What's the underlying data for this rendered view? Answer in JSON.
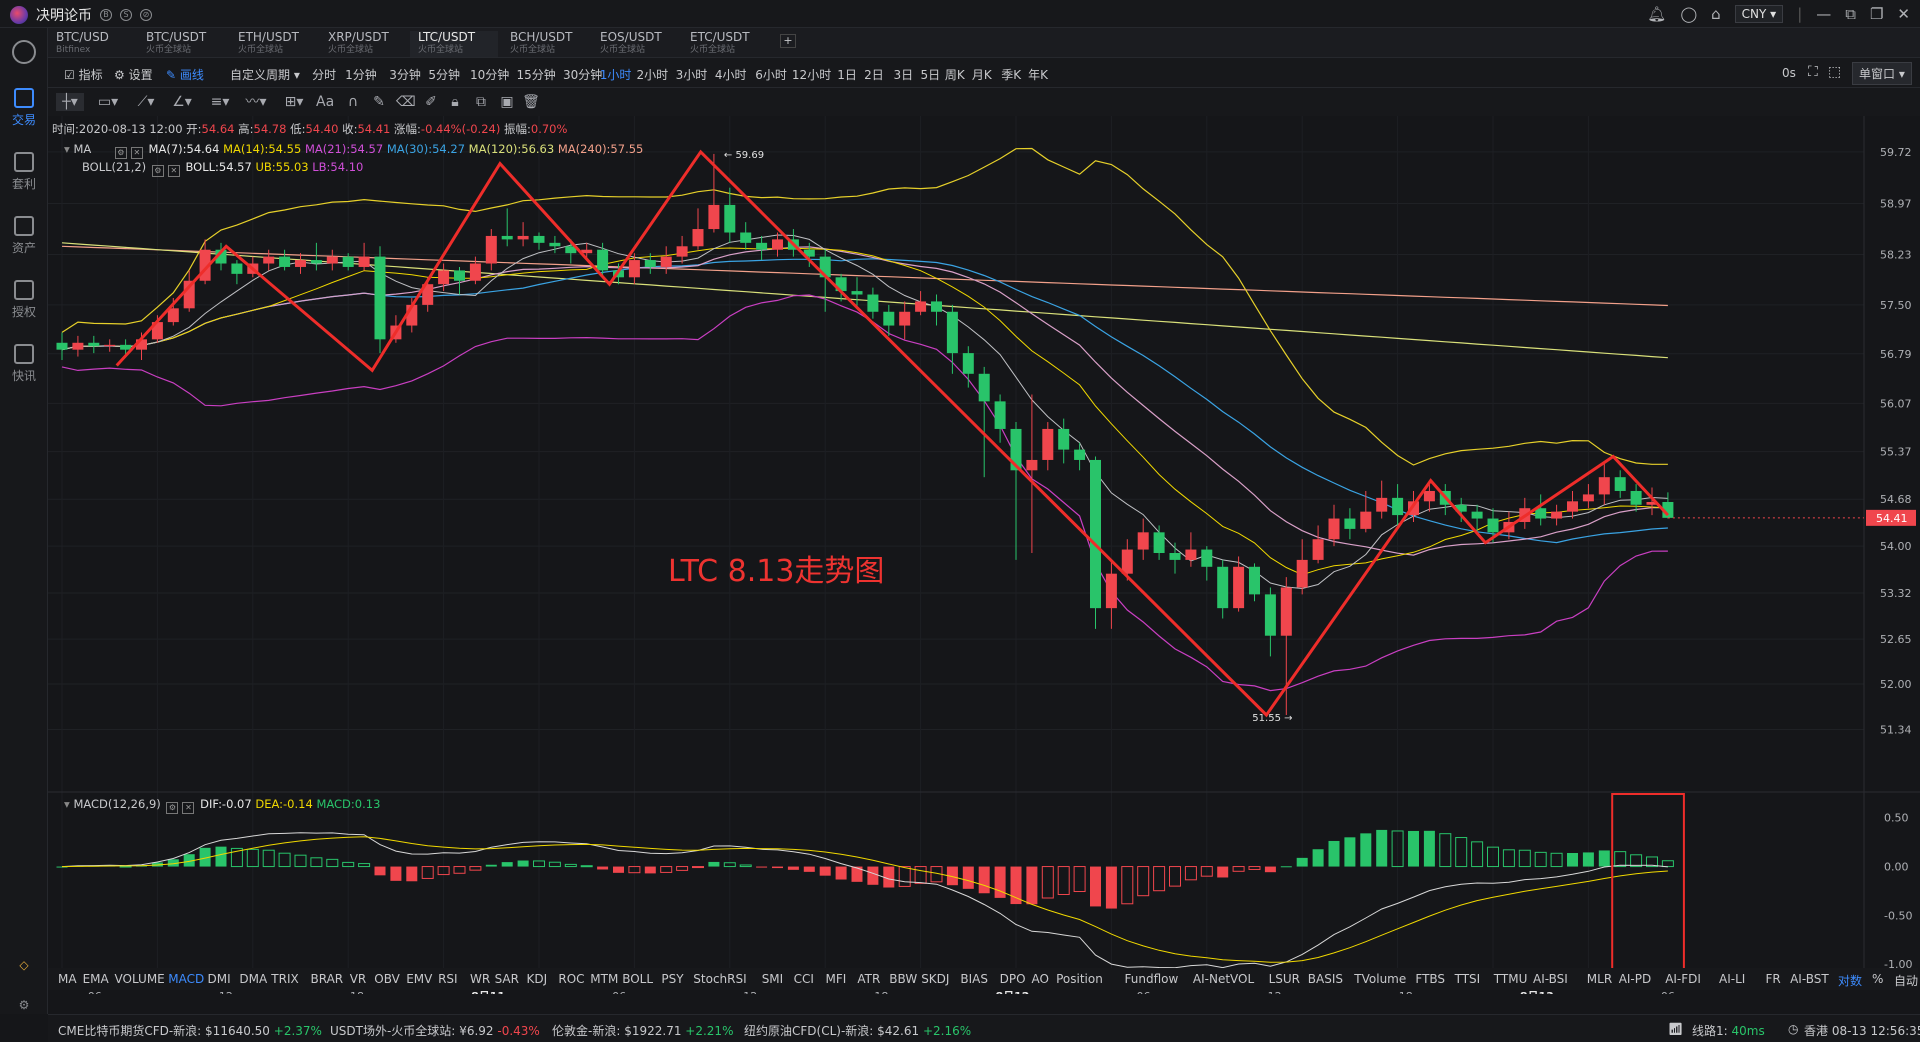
{
  "app": {
    "name": "决明论币",
    "currency": "CNY"
  },
  "sidebar": {
    "items": [
      {
        "label": "交易",
        "icon": "trade-icon",
        "active": true
      },
      {
        "label": "套利",
        "icon": "arbitrage-icon"
      },
      {
        "label": "资产",
        "icon": "assets-icon"
      },
      {
        "label": "授权",
        "icon": "authorize-icon"
      },
      {
        "label": "快讯",
        "icon": "news-icon"
      }
    ]
  },
  "tabs": [
    {
      "pair": "BTC/USD",
      "exchange": "Bitfinex"
    },
    {
      "pair": "BTC/USDT",
      "exchange": "火币全球站"
    },
    {
      "pair": "ETH/USDT",
      "exchange": "火币全球站"
    },
    {
      "pair": "XRP/USDT",
      "exchange": "火币全球站"
    },
    {
      "pair": "LTC/USDT",
      "exchange": "火币全球站",
      "active": true
    },
    {
      "pair": "BCH/USDT",
      "exchange": "火币全球站"
    },
    {
      "pair": "EOS/USDT",
      "exchange": "火币全球站"
    },
    {
      "pair": "ETC/USDT",
      "exchange": "火币全球站"
    }
  ],
  "period_bar": {
    "indicators_label": "指标",
    "settings_label": "设置",
    "draw_label": "画线",
    "custom_period_label": "自定义周期",
    "periods": [
      "分时",
      "1分钟",
      "3分钟",
      "5分钟",
      "10分钟",
      "15分钟",
      "30分钟",
      "1小时",
      "2小时",
      "3小时",
      "4小时",
      "6小时",
      "12小时",
      "1日",
      "2日",
      "3日",
      "5日",
      "周K",
      "月K",
      "季K",
      "年K"
    ],
    "active_period": "1小时",
    "refresh": "0s",
    "window_mode": "单窗口"
  },
  "info": {
    "time_label": "时间:",
    "time": "2020-08-13 12:00",
    "open_label": "开:",
    "open": "54.64",
    "high_label": "高:",
    "high": "54.78",
    "low_label": "低:",
    "low": "54.40",
    "close_label": "收:",
    "close": "54.41",
    "change_label": "涨幅:",
    "change": "-0.44%(-0.24)",
    "amp_label": "振幅:",
    "amp": "0.70%"
  },
  "ma_legend": {
    "name": "MA",
    "items": [
      {
        "label": "MA(7):54.64",
        "color": "#e8e8e8"
      },
      {
        "label": "MA(14):54.55",
        "color": "#f0d800"
      },
      {
        "label": "MA(21):54.57",
        "color": "#d04fd8"
      },
      {
        "label": "MA(30):54.27",
        "color": "#3aa3e3"
      },
      {
        "label": "MA(120):56.63",
        "color": "#d9e07a"
      },
      {
        "label": "MA(240):57.55",
        "color": "#f2a08a"
      }
    ]
  },
  "boll_legend": {
    "name": "BOLL(21,2)",
    "items": [
      {
        "label": "BOLL:54.57",
        "color": "#e8e8e8"
      },
      {
        "label": "UB:55.03",
        "color": "#f0d800"
      },
      {
        "label": "LB:54.10",
        "color": "#d04fd8"
      }
    ]
  },
  "macd_legend": {
    "name": "MACD(12,26,9)",
    "items": [
      {
        "label": "DIF:-0.07",
        "color": "#e8e8e8"
      },
      {
        "label": "DEA:-0.14",
        "color": "#f0d800"
      },
      {
        "label": "MACD:0.13",
        "color": "#29c46a"
      }
    ]
  },
  "price_axis": [
    "59.72",
    "58.97",
    "58.23",
    "57.50",
    "56.79",
    "56.07",
    "55.37",
    "54.68",
    "54.00",
    "53.32",
    "52.65",
    "52.00",
    "51.34"
  ],
  "current_price": "54.41",
  "macd_axis": [
    "0.50",
    "0.00",
    "-0.50",
    "-1.00"
  ],
  "time_axis": [
    {
      "label": "06",
      "bold": false
    },
    {
      "label": "12",
      "bold": false
    },
    {
      "label": "18",
      "bold": false
    },
    {
      "label": "8月11",
      "bold": true
    },
    {
      "label": "06",
      "bold": false
    },
    {
      "label": "12",
      "bold": false
    },
    {
      "label": "18",
      "bold": false
    },
    {
      "label": "8月12",
      "bold": true
    },
    {
      "label": "06",
      "bold": false
    },
    {
      "label": "12",
      "bold": false
    },
    {
      "label": "18",
      "bold": false
    },
    {
      "label": "8月13",
      "bold": true
    },
    {
      "label": "06",
      "bold": false
    }
  ],
  "axis_modes": {
    "log": "对数",
    "pct": "%",
    "auto": "自动"
  },
  "annotation": "LTC 8.13走势图",
  "price_labels": {
    "high": "59.69",
    "low": "51.55"
  },
  "indicators": [
    "MA",
    "EMA",
    "VOLUME",
    "MACD",
    "DMI",
    "DMA",
    "TRIX",
    "BRAR",
    "VR",
    "OBV",
    "EMV",
    "RSI",
    "WR",
    "SAR",
    "KDJ",
    "ROC",
    "MTM",
    "BOLL",
    "PSY",
    "StochRSI",
    "SMI",
    "CCI",
    "MFI",
    "ATR",
    "BBW",
    "SKDJ",
    "BIAS",
    "DPO",
    "AO",
    "Position",
    "Fundflow",
    "AI-NetVOL",
    "LSUR",
    "BASIS",
    "TVolume",
    "FTBS",
    "TTSI",
    "TTMU",
    "AI-BSI",
    "MLR",
    "AI-PD",
    "AI-FDI",
    "AI-LI",
    "FR",
    "AI-BST"
  ],
  "active_indicator": "MACD",
  "status_bar": {
    "tickers": [
      {
        "name": "CME比特币期货CFD-新浪:",
        "price": "$11640.50",
        "change": "+2.37%",
        "dir": "up"
      },
      {
        "name": "USDT场外-火币全球站:",
        "price": "¥6.92",
        "change": "-0.43%",
        "dir": "down"
      },
      {
        "name": "伦敦金-新浪:",
        "price": "$1922.71",
        "change": "+2.21%",
        "dir": "up"
      },
      {
        "name": "纽约原油CFD(CL)-新浪:",
        "price": "$42.61",
        "change": "+2.16%",
        "dir": "up"
      }
    ],
    "line_label": "线路1:",
    "latency": "40ms",
    "location": "香港 08-13 12:56:35"
  },
  "chart_data": {
    "type": "candlestick",
    "title": "",
    "ylim": [
      51.1,
      59.95
    ],
    "series_note": "LTC/USDT 1小时",
    "x_start": "2020-08-10 03:00",
    "interval": "1h",
    "candles": [
      [
        56.95,
        56.85,
        57.1,
        56.7
      ],
      [
        56.85,
        56.95,
        57.05,
        56.75
      ],
      [
        56.95,
        56.9,
        57.05,
        56.8
      ],
      [
        56.9,
        56.92,
        57.0,
        56.82
      ],
      [
        56.92,
        56.85,
        57.0,
        56.78
      ],
      [
        56.85,
        57.0,
        57.1,
        56.7
      ],
      [
        57.0,
        57.25,
        57.35,
        56.95
      ],
      [
        57.25,
        57.45,
        57.6,
        57.2
      ],
      [
        57.45,
        57.85,
        58.0,
        57.4
      ],
      [
        57.85,
        58.3,
        58.45,
        57.8
      ],
      [
        58.3,
        58.1,
        58.4,
        58.0
      ],
      [
        58.1,
        57.95,
        58.15,
        57.8
      ],
      [
        57.95,
        58.1,
        58.2,
        57.9
      ],
      [
        58.1,
        58.2,
        58.3,
        58.0
      ],
      [
        58.2,
        58.05,
        58.3,
        58.0
      ],
      [
        58.05,
        58.15,
        58.25,
        57.95
      ],
      [
        58.15,
        58.1,
        58.4,
        58.0
      ],
      [
        58.1,
        58.2,
        58.3,
        58.0
      ],
      [
        58.2,
        58.05,
        58.25,
        58.0
      ],
      [
        58.05,
        58.2,
        58.4,
        58.0
      ],
      [
        58.2,
        57.0,
        58.35,
        56.8
      ],
      [
        57.0,
        57.2,
        57.35,
        56.95
      ],
      [
        57.2,
        57.5,
        57.6,
        57.1
      ],
      [
        57.5,
        57.8,
        57.9,
        57.4
      ],
      [
        57.8,
        58.0,
        58.1,
        57.7
      ],
      [
        58.0,
        57.85,
        58.05,
        57.65
      ],
      [
        57.85,
        58.1,
        58.2,
        57.8
      ],
      [
        58.1,
        58.5,
        58.6,
        58.0
      ],
      [
        58.5,
        58.45,
        58.9,
        58.35
      ],
      [
        58.45,
        58.5,
        58.7,
        58.35
      ],
      [
        58.5,
        58.4,
        58.55,
        58.3
      ],
      [
        58.4,
        58.35,
        58.5,
        58.25
      ],
      [
        58.35,
        58.25,
        58.45,
        58.1
      ],
      [
        58.25,
        58.3,
        58.4,
        58.15
      ],
      [
        58.3,
        58.0,
        58.4,
        57.9
      ],
      [
        58.0,
        57.9,
        58.1,
        57.8
      ],
      [
        57.9,
        58.15,
        58.25,
        57.8
      ],
      [
        58.15,
        58.05,
        58.25,
        57.95
      ],
      [
        58.05,
        58.2,
        58.35,
        57.95
      ],
      [
        58.2,
        58.35,
        58.5,
        58.1
      ],
      [
        58.35,
        58.6,
        58.9,
        58.3
      ],
      [
        58.6,
        58.95,
        59.69,
        58.55
      ],
      [
        58.95,
        58.55,
        59.2,
        58.4
      ],
      [
        58.55,
        58.4,
        58.7,
        58.3
      ],
      [
        58.4,
        58.3,
        58.5,
        58.15
      ],
      [
        58.3,
        58.45,
        58.55,
        58.2
      ],
      [
        58.45,
        58.3,
        58.6,
        58.2
      ],
      [
        58.3,
        58.2,
        58.4,
        58.05
      ],
      [
        58.2,
        57.9,
        58.3,
        57.4
      ],
      [
        57.9,
        57.7,
        57.95,
        57.55
      ],
      [
        57.7,
        57.65,
        57.9,
        57.45
      ],
      [
        57.65,
        57.4,
        57.75,
        57.3
      ],
      [
        57.4,
        57.2,
        57.5,
        57.05
      ],
      [
        57.2,
        57.4,
        57.55,
        57.0
      ],
      [
        57.4,
        57.55,
        57.7,
        57.35
      ],
      [
        57.55,
        57.4,
        57.65,
        57.2
      ],
      [
        57.4,
        56.8,
        57.5,
        56.5
      ],
      [
        56.8,
        56.5,
        56.9,
        56.3
      ],
      [
        56.5,
        56.1,
        56.6,
        55.0
      ],
      [
        56.1,
        55.7,
        56.2,
        55.5
      ],
      [
        55.7,
        55.1,
        55.8,
        53.8
      ],
      [
        55.1,
        55.25,
        56.2,
        53.9
      ],
      [
        55.25,
        55.7,
        55.8,
        55.1
      ],
      [
        55.7,
        55.4,
        55.85,
        55.2
      ],
      [
        55.4,
        55.25,
        55.5,
        55.1
      ],
      [
        55.25,
        53.1,
        55.3,
        52.8
      ],
      [
        53.1,
        53.6,
        53.8,
        52.8
      ],
      [
        53.6,
        53.95,
        54.1,
        53.5
      ],
      [
        53.95,
        54.2,
        54.4,
        53.8
      ],
      [
        54.2,
        53.9,
        54.3,
        53.8
      ],
      [
        53.9,
        53.8,
        54.05,
        53.6
      ],
      [
        53.8,
        53.95,
        54.2,
        53.7
      ],
      [
        53.95,
        53.7,
        54.0,
        53.5
      ],
      [
        53.7,
        53.1,
        53.8,
        52.95
      ],
      [
        53.1,
        53.7,
        53.85,
        53.05
      ],
      [
        53.7,
        53.3,
        53.75,
        53.2
      ],
      [
        53.3,
        52.7,
        53.4,
        52.4
      ],
      [
        52.7,
        53.4,
        53.55,
        51.55
      ],
      [
        53.4,
        53.8,
        54.1,
        53.3
      ],
      [
        53.8,
        54.1,
        54.3,
        53.75
      ],
      [
        54.1,
        54.4,
        54.6,
        54.0
      ],
      [
        54.4,
        54.25,
        54.55,
        54.1
      ],
      [
        54.25,
        54.5,
        54.8,
        54.2
      ],
      [
        54.5,
        54.7,
        54.95,
        54.4
      ],
      [
        54.7,
        54.45,
        54.9,
        54.3
      ],
      [
        54.45,
        54.65,
        54.8,
        54.35
      ],
      [
        54.65,
        54.8,
        54.95,
        54.5
      ],
      [
        54.8,
        54.6,
        54.9,
        54.45
      ],
      [
        54.6,
        54.5,
        54.7,
        54.35
      ],
      [
        54.5,
        54.4,
        54.6,
        54.2
      ],
      [
        54.4,
        54.2,
        54.55,
        54.05
      ],
      [
        54.2,
        54.35,
        54.5,
        54.1
      ],
      [
        54.35,
        54.55,
        54.7,
        54.25
      ],
      [
        54.55,
        54.4,
        54.75,
        54.3
      ],
      [
        54.4,
        54.5,
        54.6,
        54.3
      ],
      [
        54.5,
        54.65,
        54.8,
        54.4
      ],
      [
        54.65,
        54.75,
        54.9,
        54.55
      ],
      [
        54.75,
        55.0,
        55.2,
        54.6
      ],
      [
        55.0,
        54.8,
        55.1,
        54.7
      ],
      [
        54.8,
        54.6,
        54.9,
        54.5
      ],
      [
        54.6,
        54.64,
        54.85,
        54.45
      ],
      [
        54.64,
        54.41,
        54.78,
        54.4
      ]
    ]
  }
}
